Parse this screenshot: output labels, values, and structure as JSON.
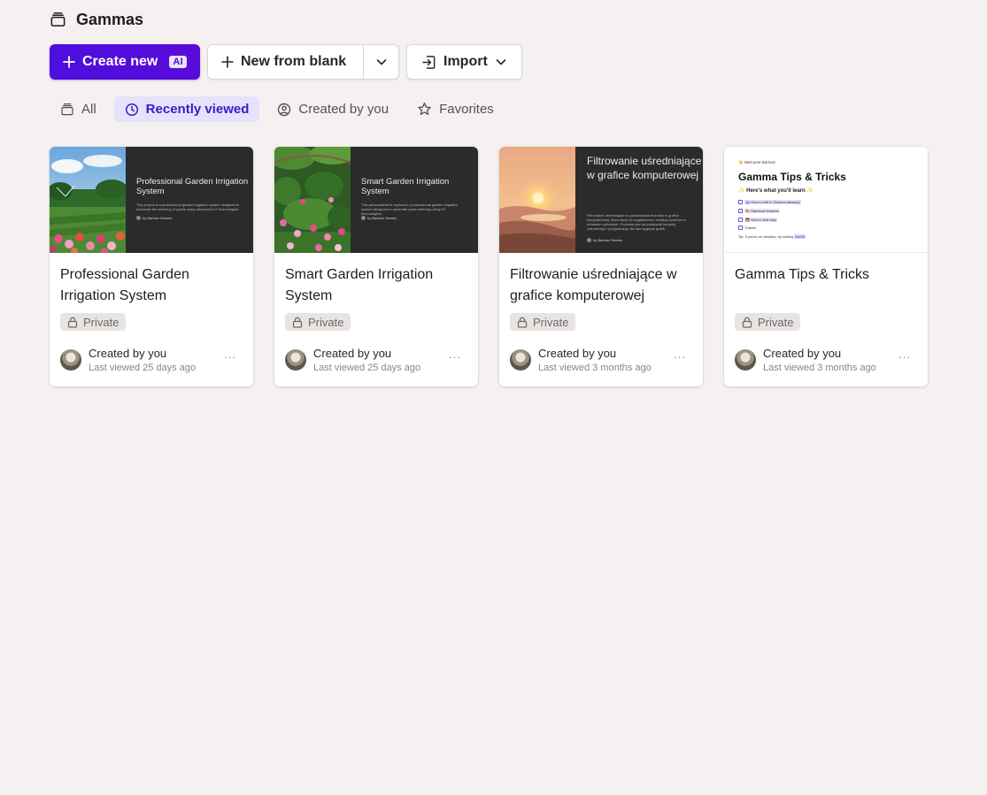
{
  "header": {
    "title": "Gammas",
    "icon": "stack-icon"
  },
  "toolbar": {
    "create_label": "Create new",
    "create_badge": "AI",
    "blank_label": "New from blank",
    "import_label": "Import"
  },
  "filters": [
    {
      "label": "All",
      "icon": "stack-icon",
      "active": false
    },
    {
      "label": "Recently viewed",
      "icon": "clock-icon",
      "active": true
    },
    {
      "label": "Created by you",
      "icon": "user-circle-icon",
      "active": false
    },
    {
      "label": "Favorites",
      "icon": "star-icon",
      "active": false
    }
  ],
  "colors": {
    "primary": "#4d0fe0",
    "active_tab_bg": "#e6e2fb",
    "active_tab_text": "#3a1cc4"
  },
  "cards": [
    {
      "title": "Professional Garden Irrigation System",
      "thumb_title": "Professional Garden Irrigation System",
      "thumb_desc": "This project is a professional garden irrigation system designed to automate the watering of plants using advanced IoT technologies.",
      "thumb_by": "by Bartosz Seśmiu",
      "badge": "Private",
      "created": "Created by you",
      "viewed": "Last viewed 25 days ago",
      "more": "..."
    },
    {
      "title": "Smart Garden Irrigation System",
      "thumb_title": "Smart Garden Irrigation System",
      "thumb_desc": "This personalized is explored; a professional garden irrigation system designed to automate plant watering using IoT technologies.",
      "thumb_by": "by Bartosz Seśmiu",
      "badge": "Private",
      "created": "Created by you",
      "viewed": "Last viewed 25 days ago",
      "more": "..."
    },
    {
      "title": "Filtrowanie uśredniające w grafice komputerowej",
      "thumb_title": "Filtrowanie uśredniające w grafice komputerowej",
      "thumb_desc": "Filtrowanie uśredniające to podstawowa technika w grafice komputerowej, która służy do wygładzania i redukcji szumów w obrazach cyfrowych. Pozwala ona na uzyskanie bardziej naturalnego i przyjemnego dla oka wyglądu grafik.",
      "thumb_by": "by Bartosz Seśmiu",
      "badge": "Private",
      "created": "Created by you",
      "viewed": "Last viewed 3 months ago",
      "more": "..."
    },
    {
      "title": "Gamma Tips & Tricks",
      "thumb_welcome": "👋 Welcome Bartosz",
      "thumb_title": "Gamma Tips & Tricks",
      "thumb_sub": "✨ Here's what you'll learn ✨",
      "thumb_rows": [
        "🤖 How to edit in Gamma (always)",
        "🎨 Standout features",
        "🧑 How to find help",
        "Thanks"
      ],
      "thumb_foot_a": "Tip: If you're on desktop, try adding",
      "thumb_foot_hl": "/scroll",
      "badge": "Private",
      "created": "Created by you",
      "viewed": "Last viewed 3 months ago",
      "more": "..."
    }
  ]
}
